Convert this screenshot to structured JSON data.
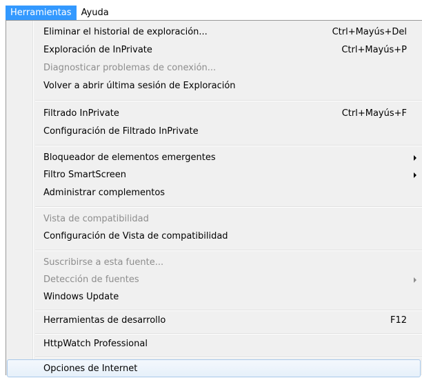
{
  "menubar": {
    "items": [
      {
        "label": "Herramientas"
      },
      {
        "label": "Ayuda"
      }
    ]
  },
  "menu": {
    "items": [
      {
        "label": "Eliminar el historial de exploración...",
        "shortcut": "Ctrl+Mayús+Del"
      },
      {
        "label": "Exploración de InPrivate",
        "shortcut": "Ctrl+Mayús+P"
      },
      {
        "label": "Diagnosticar problemas de conexión..."
      },
      {
        "label": "Volver a abrir última sesión de Exploración"
      },
      {
        "label": "Filtrado InPrivate",
        "shortcut": "Ctrl+Mayús+F"
      },
      {
        "label": "Configuración de Filtrado InPrivate"
      },
      {
        "label": "Bloqueador de elementos emergentes"
      },
      {
        "label": "Filtro SmartScreen"
      },
      {
        "label": "Administrar complementos"
      },
      {
        "label": "Vista de compatibilidad"
      },
      {
        "label": "Configuración de Vista de compatibilidad"
      },
      {
        "label": "Suscribirse a esta fuente..."
      },
      {
        "label": "Detección de fuentes"
      },
      {
        "label": "Windows Update"
      },
      {
        "label": "Herramientas de desarrollo",
        "shortcut": "F12"
      },
      {
        "label": "HttpWatch Professional"
      },
      {
        "label": "Opciones de Internet"
      }
    ]
  },
  "colors": {
    "menubar_active_bg": "#3399ff",
    "menu_bg": "#f0f0f0",
    "disabled_text": "#8d8d8d",
    "highlight_border": "#a8c8ea"
  }
}
